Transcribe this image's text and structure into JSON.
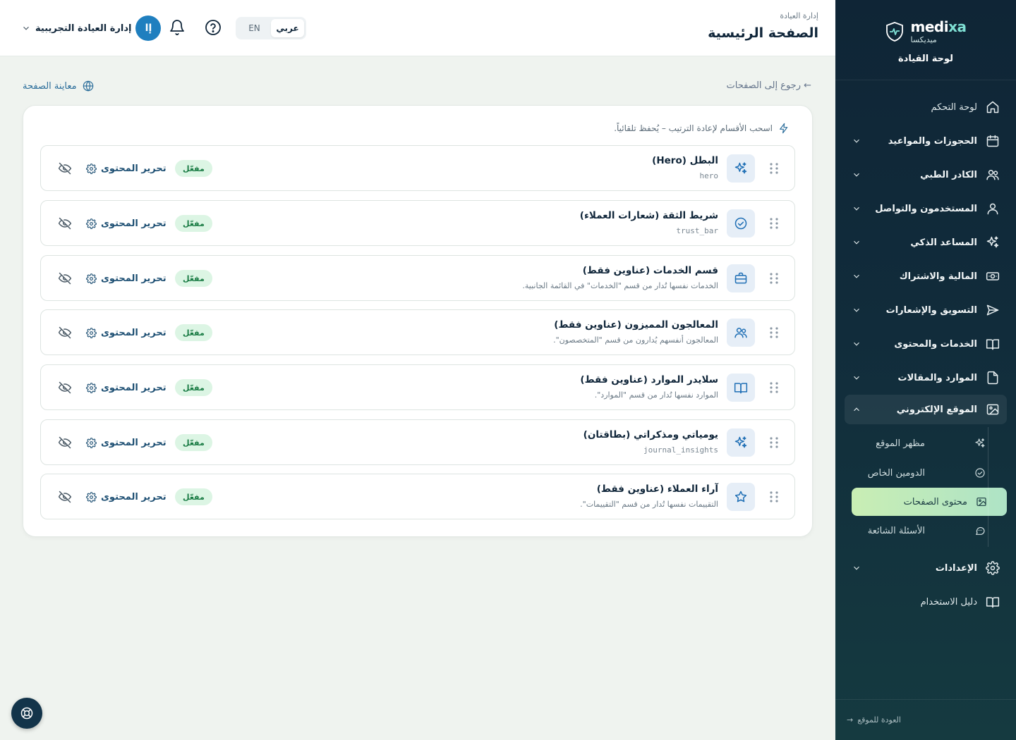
{
  "brand": {
    "name_en_prefix": "medi",
    "name_en_suffix": "xa",
    "name_ar": "ميديكسا",
    "subtitle": "لوحة القيادة"
  },
  "sidebar": {
    "items": [
      {
        "label": "لوحة التحكم",
        "icon": "home-icon",
        "has_chevron": false
      },
      {
        "label": "الحجوزات والمواعيد",
        "icon": "calendar-icon",
        "has_chevron": true
      },
      {
        "label": "الكادر الطبي",
        "icon": "users-icon",
        "has_chevron": true
      },
      {
        "label": "المستخدمون والتواصل",
        "icon": "user-icon",
        "has_chevron": true
      },
      {
        "label": "المساعد الذكي",
        "icon": "sparkles-icon",
        "has_chevron": true
      },
      {
        "label": "المالية والاشتراك",
        "icon": "banknote-icon",
        "has_chevron": true
      },
      {
        "label": "التسويق والإشعارات",
        "icon": "send-icon",
        "has_chevron": true
      },
      {
        "label": "الخدمات والمحتوى",
        "icon": "book-icon",
        "has_chevron": true
      },
      {
        "label": "الموارد والمقالات",
        "icon": "file-icon",
        "has_chevron": true
      },
      {
        "label": "الموقع الإلكتروني",
        "icon": "image-icon",
        "has_chevron": true,
        "open": true
      }
    ],
    "submenu": [
      {
        "label": "مظهر الموقع",
        "icon": "sparkles-icon"
      },
      {
        "label": "الدومين الخاص",
        "icon": "check-circle-icon"
      },
      {
        "label": "محتوى الصفحات",
        "icon": "image-icon",
        "active": true
      },
      {
        "label": "الأسئلة الشائعة",
        "icon": "message-icon"
      }
    ],
    "after": [
      {
        "label": "الإعدادات",
        "icon": "gear-icon",
        "has_chevron": true
      },
      {
        "label": "دليل الاستخدام",
        "icon": "book-icon",
        "has_chevron": false
      }
    ],
    "footer_label": "العودة للموقع"
  },
  "header": {
    "breadcrumb": "إدارة العيادة",
    "title": "الصفحة الرئيسية",
    "lang": {
      "ar": "عربي",
      "en": "EN",
      "active": "ar"
    },
    "user": {
      "initials": "إا",
      "name": "إدارة العيادة التجريبية"
    }
  },
  "main": {
    "back_label": "← رجوع إلى الصفحات",
    "preview_label": "معاينة الصفحة",
    "hint": "اسحب الأقسام لإعادة الترتيب – يُحفظ تلقائياً.",
    "status_label": "مفعّل",
    "edit_label": "تحرير المحتوى",
    "sections": [
      {
        "title": "البطل (Hero)",
        "subtitle": "hero",
        "mono": true,
        "icon": "sparkles-icon"
      },
      {
        "title": "شريط الثقة (شعارات العملاء)",
        "subtitle": "trust_bar",
        "mono": true,
        "icon": "check-circle-icon"
      },
      {
        "title": "قسم الخدمات (عناوين فقط)",
        "subtitle": "الخدمات نفسها تُدار من قسم \"الخدمات\" في القائمة الجانبية.",
        "mono": false,
        "icon": "briefcase-icon"
      },
      {
        "title": "المعالجون المميزون (عناوين فقط)",
        "subtitle": "المعالجون أنفسهم يُدارون من قسم \"المتخصصون\".",
        "mono": false,
        "icon": "users-icon"
      },
      {
        "title": "سلايدر الموارد (عناوين فقط)",
        "subtitle": "الموارد نفسها تُدار من قسم \"الموارد\".",
        "mono": false,
        "icon": "book-icon"
      },
      {
        "title": "يومياتي ومذكراتي (بطاقتان)",
        "subtitle": "journal_insights",
        "mono": true,
        "icon": "sparkles-icon"
      },
      {
        "title": "آراء العملاء (عناوين فقط)",
        "subtitle": "التقييمات نفسها تُدار من قسم \"التقييمات\".",
        "mono": false,
        "icon": "star-icon"
      }
    ]
  },
  "colors": {
    "sidebar_bg": "#0f2536",
    "accent": "#1f7fbf",
    "active_item": "#c9eeb4",
    "badge_bg": "#dcf5e4",
    "badge_text": "#177a42"
  }
}
